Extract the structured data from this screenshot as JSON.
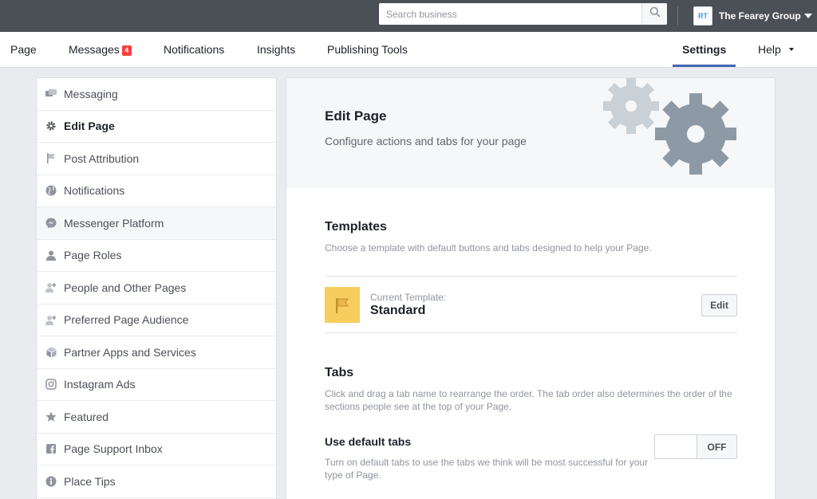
{
  "topbar": {
    "search_placeholder": "Search business",
    "avatar_initials": "RT",
    "account_name": "The Fearey Group"
  },
  "nav": {
    "page": "Page",
    "messages": "Messages",
    "messages_badge": "4",
    "notifications": "Notifications",
    "insights": "Insights",
    "publishing_tools": "Publishing Tools",
    "settings": "Settings",
    "help": "Help"
  },
  "sidebar": {
    "items": [
      {
        "label": "Messaging",
        "icon": "messaging-icon"
      },
      {
        "label": "Edit Page",
        "icon": "gear-icon",
        "active": true
      },
      {
        "label": "Post Attribution",
        "icon": "flag-icon"
      },
      {
        "label": "Notifications",
        "icon": "globe-icon"
      },
      {
        "label": "Messenger Platform",
        "icon": "messenger-icon"
      },
      {
        "label": "Page Roles",
        "icon": "person-icon"
      },
      {
        "label": "People and Other Pages",
        "icon": "person-add-icon"
      },
      {
        "label": "Preferred Page Audience",
        "icon": "person-add-icon"
      },
      {
        "label": "Partner Apps and Services",
        "icon": "cube-icon"
      },
      {
        "label": "Instagram Ads",
        "icon": "instagram-icon"
      },
      {
        "label": "Featured",
        "icon": "star-icon"
      },
      {
        "label": "Page Support Inbox",
        "icon": "facebook-icon"
      },
      {
        "label": "Place Tips",
        "icon": "info-icon"
      }
    ]
  },
  "main": {
    "header_title": "Edit Page",
    "header_subtitle": "Configure actions and tabs for your page",
    "templates_title": "Templates",
    "templates_desc": "Choose a template with default buttons and tabs designed to help your Page.",
    "current_template_label": "Current Template:",
    "current_template_name": "Standard",
    "edit_button": "Edit",
    "tabs_title": "Tabs",
    "tabs_desc_line1": "Click and drag a tab name to rearrange the order. The tab order also determines the order of the",
    "tabs_desc_line2": "sections people see at the top of your Page.",
    "default_tabs_title": "Use default tabs",
    "default_tabs_desc_line1": "Turn on default tabs to use the tabs we think will be most successful for your",
    "default_tabs_desc_line2": "type of Page.",
    "toggle_state": "OFF"
  },
  "colors": {
    "topbar": "#4b4f56",
    "accent": "#4267b2",
    "badge": "#fa3e3e",
    "template_icon_bg": "#f7cd5d",
    "gear_dark": "#8d9aa5",
    "gear_light": "#c9d0d6"
  }
}
